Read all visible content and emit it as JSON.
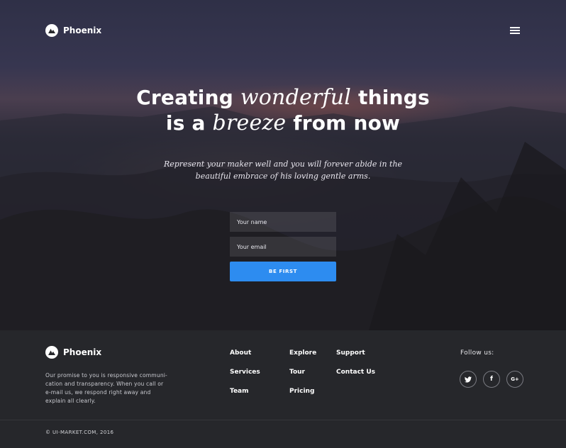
{
  "header": {
    "brand": "Phoenix",
    "logo_icon": "mountain-icon",
    "menu_icon": "hamburger-menu-icon"
  },
  "hero": {
    "headline_1_a": "Creating ",
    "headline_1_b": "wonderful",
    "headline_1_c": " things",
    "headline_2_a": "is a ",
    "headline_2_b": "breeze",
    "headline_2_c": " from now",
    "subline_1": "Represent your maker well and you will forever abide in the",
    "subline_2": "beautiful embrace of his loving gentle arms."
  },
  "form": {
    "name_placeholder": "Your name",
    "email_placeholder": "Your email",
    "submit_label": "BE FIRST"
  },
  "footer": {
    "brand": "Phoenix",
    "promise": [
      "Our promise to you is responsive communi-",
      "cation and transparency. When you call or",
      "e-mail us, we respond right away and",
      "explain all clearly."
    ],
    "links": {
      "about": "About",
      "services": "Services",
      "team": "Team",
      "explore": "Explore",
      "tour": "Tour",
      "pricing": "Pricing",
      "support": "Support",
      "contact": "Contact Us"
    },
    "follow_label": "Follow us:",
    "social": [
      {
        "name": "twitter-icon",
        "glyph": ""
      },
      {
        "name": "facebook-icon",
        "glyph": "f"
      },
      {
        "name": "google-plus-icon",
        "glyph": "G+"
      }
    ],
    "copyright": "© UI-MARKET.COM, 2016"
  },
  "colors": {
    "accent": "#2d8cf0",
    "footer_bg": "#26272b"
  }
}
